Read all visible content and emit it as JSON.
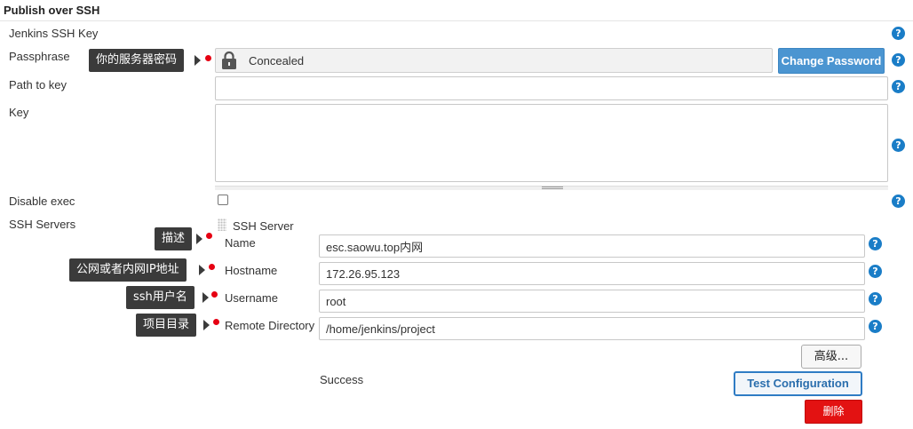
{
  "section": {
    "title": "Publish over SSH"
  },
  "fields": {
    "jenkins_ssh_key_label": "Jenkins SSH Key",
    "passphrase_label": "Passphrase",
    "passphrase_value": "Concealed",
    "change_password_label": "Change Password",
    "path_to_key_label": "Path to key",
    "path_to_key_value": "",
    "key_label": "Key",
    "key_value": "",
    "disable_exec_label": "Disable exec",
    "disable_exec_checked": false,
    "ssh_servers_label": "SSH Servers"
  },
  "ssh_server": {
    "heading": "SSH Server",
    "name_label": "Name",
    "name_value": "esc.saowu.top内网",
    "hostname_label": "Hostname",
    "hostname_value": "172.26.95.123",
    "username_label": "Username",
    "username_value": "root",
    "remote_directory_label": "Remote Directory",
    "remote_directory_value": "/home/jenkins/project",
    "advanced_label": "高级...",
    "status_text": "Success",
    "test_configuration_label": "Test Configuration",
    "delete_label": "删除"
  },
  "annotations": {
    "passphrase": "你的服务器密码",
    "name": "描述",
    "hostname": "公网或者内网IP地址",
    "username": "ssh用户名",
    "remote_directory": "项目目录"
  },
  "help_glyph": "?",
  "colors": {
    "help_icon": "#1a7dc7",
    "primary_button": "#4b95d1",
    "delete_button": "#e31212",
    "annotation_bg": "#3b3b3b",
    "annotation_dot": "#e60012"
  },
  "icons": {
    "lock": "lock-icon",
    "help": "help-icon",
    "drag": "drag-handle-icon"
  }
}
